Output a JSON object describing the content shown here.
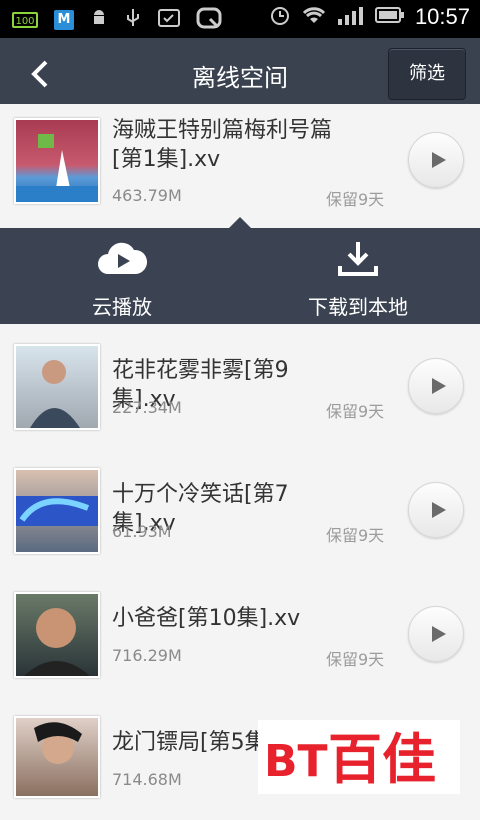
{
  "status": {
    "battery_left": "100",
    "m_label": "M",
    "time": "10:57"
  },
  "header": {
    "title": "离线空间",
    "filter_label": "筛选"
  },
  "popup": {
    "cloud_play": "云播放",
    "download_local": "下载到本地"
  },
  "items": [
    {
      "name": "海贼王特别篇梅利号篇[第1集].xv",
      "size": "463.79M",
      "keep": "保留9天"
    },
    {
      "name": "花非花雾非雾[第9集].xv",
      "size": "227.34M",
      "keep": "保留9天"
    },
    {
      "name": "十万个冷笑话[第7集].xv",
      "size": "61.93M",
      "keep": "保留9天"
    },
    {
      "name": "小爸爸[第10集].xv",
      "size": "716.29M",
      "keep": "保留9天"
    },
    {
      "name": "龙门镖局[第5集",
      "size": "714.68M",
      "keep": ""
    }
  ],
  "watermark": "百佳",
  "watermark_logo": "BT"
}
